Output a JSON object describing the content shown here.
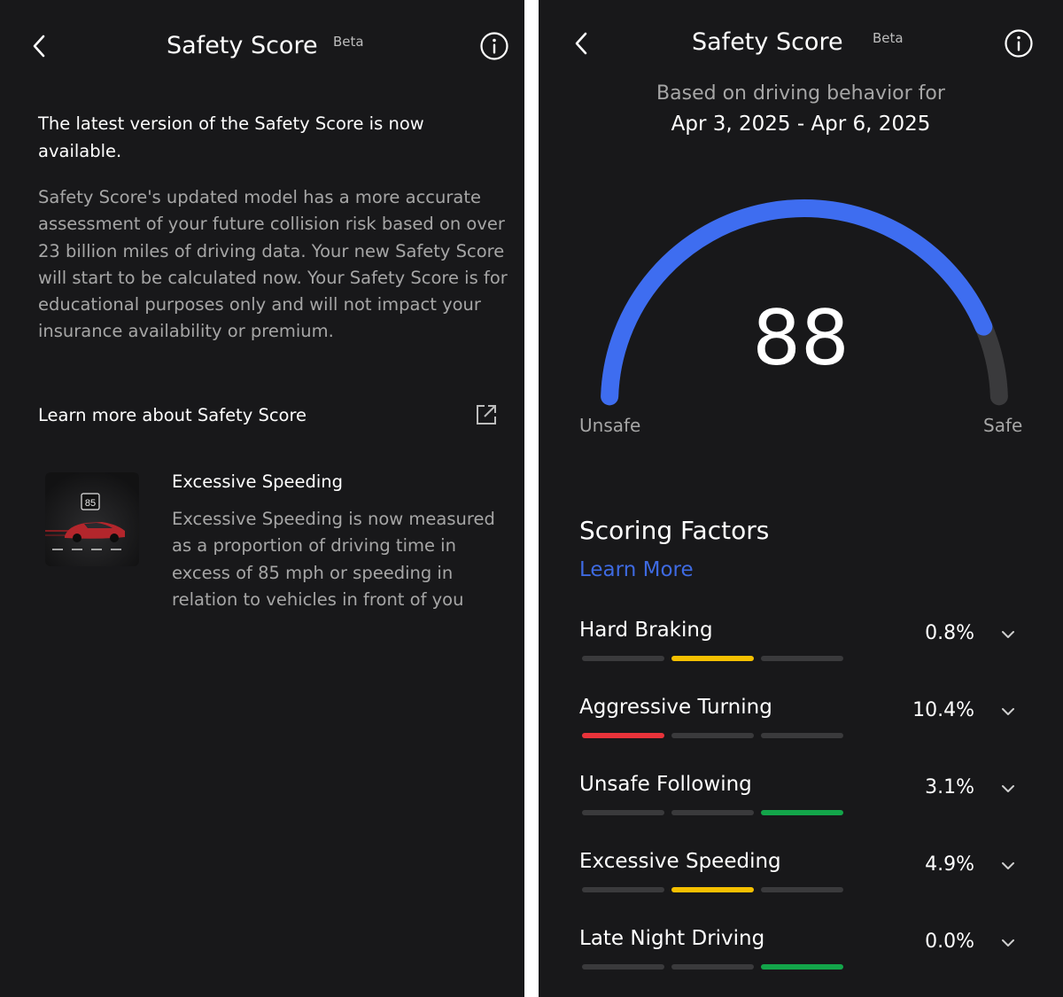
{
  "colors": {
    "background": "#18181a",
    "accent_blue": "#3e6ae1",
    "gauge_blue": "#3e6df0",
    "red": "#e8333a",
    "yellow": "#f5c000",
    "green": "#13a54a",
    "bar_off": "#3a3a3c"
  },
  "left": {
    "title": "Safety Score",
    "beta": "Beta",
    "intro_heading": "The latest version of the Safety Score is now available.",
    "intro_body": "Safety Score's updated model has a more accurate assessment of your future collision risk based on over 23 billion miles of driving data. Your new Safety Score will start to be calculated now. Your Safety Score is for educational purposes only and will not impact your insurance availability or premium.",
    "learn_more_label": "Learn more about Safety Score",
    "feature": {
      "title": "Excessive Speeding",
      "body": "Excessive Speeding is now measured as a proportion of driving time in excess of 85 mph or speeding in relation to vehicles in front of you",
      "thumb_sign": "85"
    }
  },
  "right": {
    "title": "Safety Score",
    "beta": "Beta",
    "period_label": "Based on driving behavior for",
    "period_value": "Apr 3, 2025 - Apr 6, 2025",
    "score": "88",
    "gauge_fraction": 0.88,
    "gauge_min_label": "Unsafe",
    "gauge_max_label": "Safe",
    "section_title": "Scoring Factors",
    "learn_more": "Learn More",
    "factors": [
      {
        "name": "Hard Braking",
        "value": "0.8%",
        "level_index": 1,
        "level_color": "yellow"
      },
      {
        "name": "Aggressive Turning",
        "value": "10.4%",
        "level_index": 0,
        "level_color": "red"
      },
      {
        "name": "Unsafe Following",
        "value": "3.1%",
        "level_index": 2,
        "level_color": "green"
      },
      {
        "name": "Excessive Speeding",
        "value": "4.9%",
        "level_index": 1,
        "level_color": "yellow"
      },
      {
        "name": "Late Night Driving",
        "value": "0.0%",
        "level_index": 2,
        "level_color": "green"
      }
    ]
  }
}
